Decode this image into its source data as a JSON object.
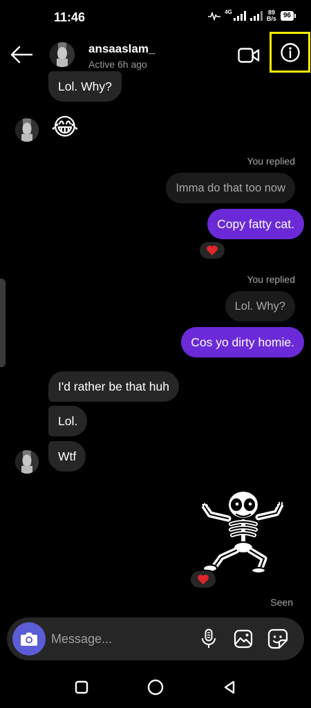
{
  "status_bar": {
    "time": "11:46",
    "network_type": "4G",
    "net_speed_value": "89",
    "net_speed_unit": "B/s",
    "battery": "96"
  },
  "header": {
    "username": "ansaaslam_",
    "status": "Active 6h ago",
    "icons": [
      "back-arrow-icon",
      "video-call-icon",
      "info-icon"
    ]
  },
  "messages": {
    "m1": {
      "text": "Lol. Why?",
      "direction": "incoming"
    },
    "m2": {
      "text": "😂",
      "direction": "incoming"
    },
    "reply1": {
      "label": "You replied",
      "quoted": "Imma do that too now",
      "text": "Copy fatty cat.",
      "reaction": "❤️"
    },
    "reply2": {
      "label": "You replied",
      "quoted": "Lol. Why?",
      "text": "Cos yo dirty homie."
    },
    "m3": {
      "text": "I'd rather be that huh",
      "direction": "incoming"
    },
    "m4": {
      "text": "Lol.",
      "direction": "incoming"
    },
    "m5": {
      "text": "Wtf",
      "direction": "incoming"
    },
    "sticker": {
      "name": "dancing-skeleton-sticker",
      "reaction": "❤️"
    },
    "seen": "Seen"
  },
  "composer": {
    "placeholder": "Message...",
    "icons": [
      "camera-icon",
      "microphone-icon",
      "gallery-icon",
      "sticker-icon"
    ]
  },
  "colors": {
    "outgoing_bubble": "#6a2ad8",
    "incoming_bubble": "#262626",
    "highlight": "#ffee00",
    "camera_button": "#5b5cd6"
  }
}
